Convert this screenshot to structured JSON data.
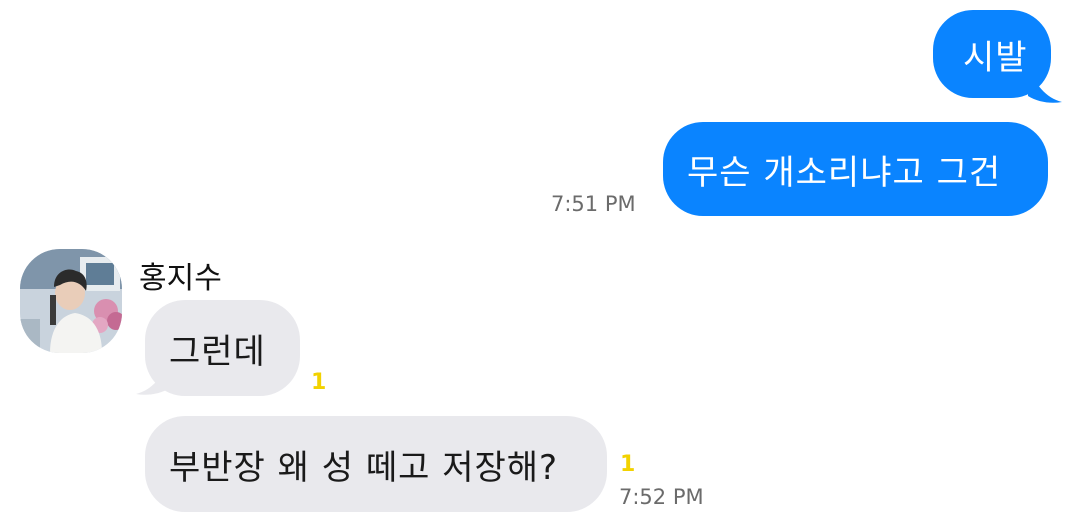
{
  "colors": {
    "sent_bubble": "#0a84ff",
    "received_bubble": "#e9e9ed",
    "unread_count": "#f2d200",
    "timestamp": "#6b6b6b"
  },
  "messages": {
    "sent_1": {
      "text": "시발"
    },
    "sent_2": {
      "text": "무슨 개소리냐고 그건",
      "time": "7:51 PM"
    },
    "sender": {
      "name": "홍지수",
      "avatar": "profile-photo"
    },
    "recv_1": {
      "text": "그런데",
      "unread": "1"
    },
    "recv_2": {
      "text": "부반장 왜 성 떼고 저장해?",
      "unread": "1",
      "time": "7:52 PM"
    }
  }
}
